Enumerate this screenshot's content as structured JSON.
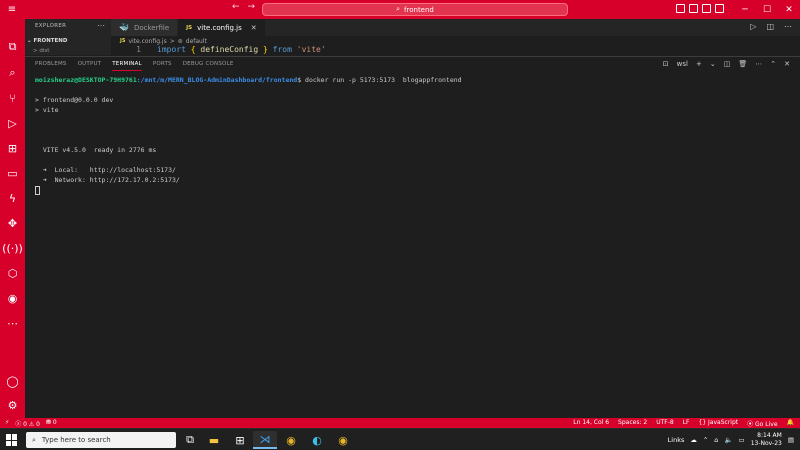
{
  "titlebar": {
    "search_text": "frontend",
    "controls": [
      "─",
      "☐",
      "✕"
    ]
  },
  "explorer": {
    "title": "EXPLORER",
    "folder": "FRONTEND",
    "item": "dist"
  },
  "tabs": [
    {
      "label": "Dockerfile",
      "icon": "docker-icon"
    },
    {
      "label": "vite.config.js",
      "icon": "js-icon",
      "badge": "JS",
      "active": true
    }
  ],
  "breadcrumb": {
    "file": "vite.config.js",
    "file_badge": "JS",
    "separator": ">",
    "symbol": "default"
  },
  "code": {
    "line_number": "1",
    "kw1": "import",
    "br1": "{",
    "fn": "defineConfig",
    "br2": "}",
    "kw2": "from",
    "str": "'vite'"
  },
  "panel": {
    "tabs": [
      "PROBLEMS",
      "OUTPUT",
      "TERMINAL",
      "PORTS",
      "DEBUG CONSOLE"
    ],
    "active_tab": "TERMINAL",
    "shell": "wsl"
  },
  "terminal": {
    "user": "moizsheraz@DESKTOP-79H9761",
    "path": ":/mnt/m/MERN_BLOG-AdminDashboard/frontend",
    "prompt_cmd": "$ docker run -p 5173:5173  blogappfrontend",
    "line1": "> frontend@0.0.0 dev",
    "line2": "> vite",
    "vite_line": "  VITE v4.5.0  ready in 2776 ms",
    "local_label": "  ➜  Local:   ",
    "local_url": "http://localhost:5173/",
    "network_label": "  ➜  Network: ",
    "network_url": "http://172.17.0.2:5173/"
  },
  "statusbar": {
    "remote": "⚡",
    "errors": "ⓧ 0 ⚠ 0",
    "ports": "⛃ 0",
    "position": "Ln 14, Col 6",
    "spaces": "Spaces: 2",
    "encoding": "UTF-8",
    "eol": "LF",
    "language": "{} JavaScript",
    "golive": "⦿ Go Live",
    "bell": "🔔"
  },
  "taskbar": {
    "search_placeholder": "Type here to search",
    "links": "Links",
    "time": "8:14 AM",
    "date": "13-Nov-23"
  }
}
